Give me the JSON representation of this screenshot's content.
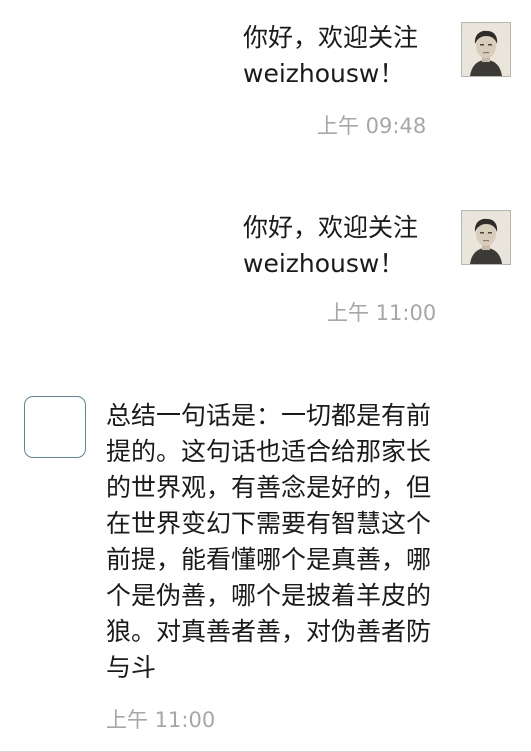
{
  "messages": [
    {
      "side": "right",
      "text_line1": "你好，欢迎关注",
      "text_line2": "weizhousw！",
      "time": "上午 09:48"
    },
    {
      "side": "right",
      "text_line1": "你好，欢迎关注",
      "text_line2": "weizhousw！",
      "time": "上午 11:00"
    },
    {
      "side": "left",
      "text": "总结一句话是：一切都是有前提的。这句话也适合给那家长的世界观，有善念是好的，但在世界变幻下需要有智慧这个前提，能看懂哪个是真善，哪个是伪善，哪个是披着羊皮的狼。对真善者善，对伪善者防与斗",
      "time": "上午 11:00"
    }
  ]
}
